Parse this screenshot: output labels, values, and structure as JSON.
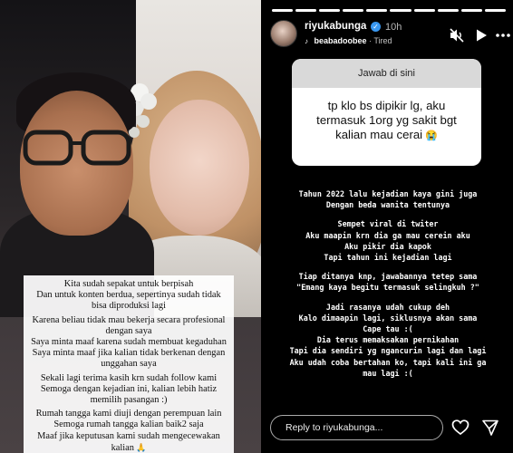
{
  "left_panel": {
    "caption_lines": [
      "Kita sudah sepakat untuk berpisah",
      "Dan untuk konten berdua, sepertinya sudah tidak",
      "bisa diproduksi lagi",
      "Karena beliau tidak mau bekerja secara profesional",
      "dengan saya",
      "Saya minta maaf karena sudah membuat kegaduhan",
      "Saya minta maaf jika kalian tidak berkenan dengan",
      "unggahan saya",
      "Sekali lagi terima kasih krn sudah follow kami",
      "Semoga dengan kejadian ini, kalian lebih hatiz",
      "memilih pasangan :)",
      "Rumah tangga kami diuji dengan perempuan lain",
      "Semoga rumah tangga kalian baik2 saja",
      "Maaf jika keputusan kami sudah mengecewakan",
      "kalian"
    ],
    "caption_gap_before": [
      3,
      8,
      11
    ],
    "end_emoji": "🙏"
  },
  "story": {
    "progress_segments": 10,
    "progress_done": 10,
    "username": "riyukabunga",
    "verified_icon": "verified-badge-icon",
    "timestamp": "10h",
    "music_artist": "beabadoobee",
    "music_separator": " · ",
    "music_track": "Tired",
    "question_box": {
      "header": "Jawab di sini",
      "answer_lines": [
        "tp klo bs dipikir lg, aku",
        "termasuk 1org yg sakit bgt",
        "kalian mau cerai"
      ],
      "answer_emoji": "😭"
    },
    "text_lines": [
      "Tahun 2022 lalu kejadian kaya gini juga",
      "Dengan beda wanita tentunya",
      "Sempet viral di twiter",
      "Aku maapin krn dia ga mau cerein aku",
      "Aku pikir dia kapok",
      "Tapi tahun ini kejadian lagi",
      "Tiap ditanya knp, jawabannya tetep sama",
      "\"Emang kaya begitu termasuk selingkuh ?\"",
      "Jadi rasanya udah cukup deh",
      "Kalo dimaapin lagi, siklusnya akan sama",
      "Cape tau :(",
      "Dia terus memaksakan pernikahan",
      "Tapi dia sendiri yg ngancurin lagi dan lagi",
      "Aku udah coba bertahan ko, tapi kali ini ga",
      "mau lagi :("
    ],
    "text_gap_before": [
      2,
      6,
      8
    ],
    "reply_placeholder": "Reply to riyukabunga...",
    "icons": {
      "mute": "speaker-muted-icon",
      "play": "play-icon",
      "more": "more-dots-icon",
      "like": "heart-icon",
      "share": "send-icon"
    }
  }
}
